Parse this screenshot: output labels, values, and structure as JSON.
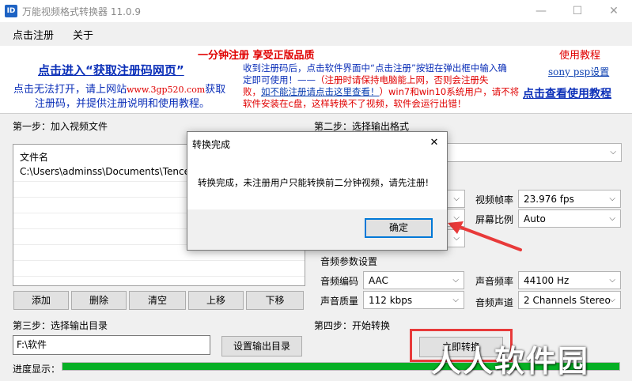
{
  "window": {
    "title": "万能视频格式转换器 11.0.9",
    "icon_label": "ID",
    "minimize": "—",
    "maximize": "☐",
    "close": "✕"
  },
  "menu": {
    "register": "点击注册",
    "about": "关于"
  },
  "ad": {
    "headline": "一分钟注册  享受正版品质",
    "get_code_link": "点击进入“获取注册码网页”",
    "fallback_line1_prefix": "点击无法打开，请上网站",
    "fallback_site": "www.3gp520.com",
    "fallback_line1_suffix": "获取",
    "fallback_line2": "注册码，并提供注册说明和使用教程。",
    "notice_line1": "收到注册码后，点击软件界面中“点击注册”按钮在弹出框中输入确",
    "notice_line2_a": "定即可使用！——",
    "notice_line2_b": "（注册时请保持电脑能上网，否则会注册失",
    "notice_line3_a": "败，",
    "notice_line3_link": "如不能注册请点击这里查看！",
    "notice_line3_b": "）win7和win10系统用户，请不将",
    "notice_line4": "软件安装在c盘，这样转换不了视频，软件会运行出错！",
    "tutorial_title": "使用教程",
    "sony_link": "sony psp设置",
    "view_tutorial_link": "点击查看使用教程"
  },
  "step1": {
    "label": "第一步：加入视频文件",
    "column_header": "文件名",
    "files": [
      "C:\\Users\\adminss\\Documents\\Tencent"
    ],
    "buttons": {
      "add": "添加",
      "delete": "删除",
      "clear": "清空",
      "move_up": "上移",
      "move_down": "下移"
    }
  },
  "step2": {
    "label": "第二步：选择输出格式",
    "video": {
      "frame_rate_label": "视频帧率",
      "frame_rate_value": "23.976 fps",
      "aspect_label": "屏幕比例",
      "aspect_value": "Auto"
    },
    "audio": {
      "section_label": "音频参数设置",
      "codec_label": "音频编码",
      "codec_value": "AAC",
      "quality_label": "声音质量",
      "quality_value": "112 kbps",
      "sample_rate_label": "声音频率",
      "sample_rate_value": "44100 Hz",
      "channels_label": "音频声道",
      "channels_value": "2 Channels Stereo"
    }
  },
  "step3": {
    "label": "第三步：选择输出目录",
    "output_dir": "F:\\软件",
    "set_dir_button": "设置输出目录"
  },
  "step4": {
    "label": "第四步：开始转换",
    "start_button": "立即转换"
  },
  "progress": {
    "label": "进度显示：",
    "fraction": 1.0
  },
  "dialog": {
    "title": "转换完成",
    "close": "✕",
    "message": "转换完成，未注册用户只能转换前二分钟视频，请先注册!",
    "ok_button": "确定"
  },
  "watermark": "人人软件园",
  "colors": {
    "accent_red": "#e83a3a",
    "progress_green": "#06b025",
    "link_blue": "#0b3fb0"
  }
}
